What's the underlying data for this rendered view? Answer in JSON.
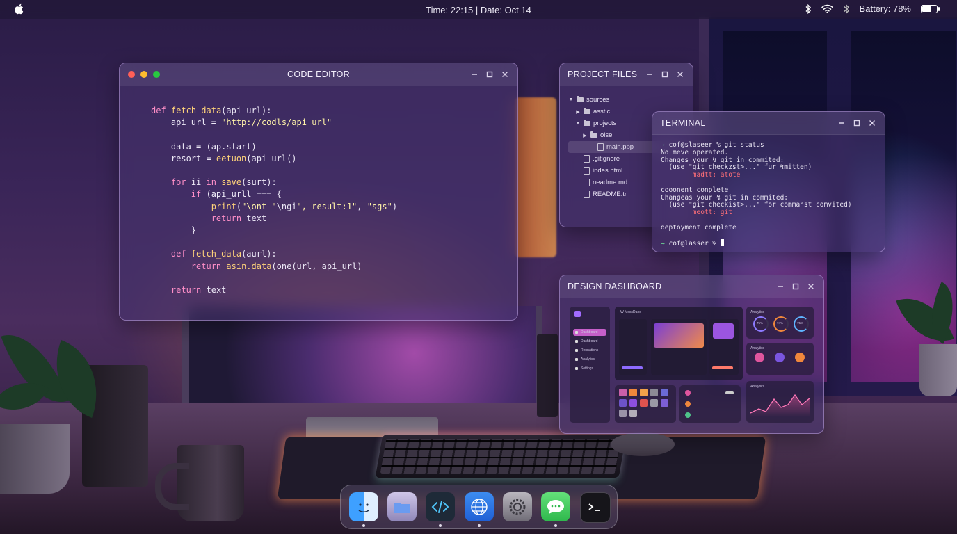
{
  "menubar": {
    "clock": "Time: 22:15 | Date: Oct 14",
    "battery": "Battery: 78%",
    "battery_level": 0.78
  },
  "code_editor": {
    "title": "CODE EDITOR",
    "lines": [
      "def fetch_data(api_url):",
      "    api_url = \"http://codls/api_url\"",
      "",
      "    data = (ap.start)",
      "    resort = eetuon(api_url()",
      "",
      "    for ii in save(surt):",
      "        if (api_urll === {",
      "            print(\"\\ont \"\\ngi\", result:1\", \"sgs\")",
      "            return text",
      "        }",
      "",
      "    def fetch_data(aurl):",
      "        return asin.data(one(url, api_url)",
      "",
      "    return text"
    ]
  },
  "project_files": {
    "title": "PROJECT FILES",
    "items": [
      {
        "label": "sources",
        "type": "folder",
        "depth": 0,
        "chevron": "open"
      },
      {
        "label": "asstic",
        "type": "folder",
        "depth": 1,
        "chevron": "closed"
      },
      {
        "label": "projects",
        "type": "folder",
        "depth": 1,
        "chevron": "open"
      },
      {
        "label": "oise",
        "type": "folder",
        "depth": 2,
        "chevron": "closed"
      },
      {
        "label": "main.ppp",
        "type": "file",
        "depth": 3,
        "selected": true
      },
      {
        "label": ".gitignore",
        "type": "file",
        "depth": 1
      },
      {
        "label": "indes.html",
        "type": "file",
        "depth": 1
      },
      {
        "label": "neadme.md",
        "type": "file",
        "depth": 1
      },
      {
        "label": "README.tr",
        "type": "file",
        "depth": 1
      }
    ]
  },
  "terminal": {
    "title": "TERMINAL",
    "lines": [
      {
        "text": "→ cof@slaseer % git status",
        "style": "prompt"
      },
      {
        "text": "No meve operated.",
        "style": "normal"
      },
      {
        "text": "Changes your ↯ git in commited:",
        "style": "normal"
      },
      {
        "text": "  (use \"git checkzst>...\" fur ↯mitten)",
        "style": "normal"
      },
      {
        "text": "        madtt: atote",
        "style": "red"
      },
      {
        "text": "",
        "style": "normal"
      },
      {
        "text": "cooonent conplete",
        "style": "normal"
      },
      {
        "text": "Changeas your ↯ git in commited:",
        "style": "normal"
      },
      {
        "text": "  (use \"git checkist>...\" for commanst comvited)",
        "style": "normal"
      },
      {
        "text": "        meott: git",
        "style": "red"
      },
      {
        "text": "",
        "style": "normal"
      },
      {
        "text": "deptoyment complete",
        "style": "normal"
      },
      {
        "text": "",
        "style": "normal"
      }
    ],
    "prompt": "cof@lasser %"
  },
  "design_dashboard": {
    "title": "DESIGN DASHBOARD",
    "app_name": "W MossDand",
    "sidebar": [
      "Dashboard",
      "Dashboard",
      "Rennations",
      "Analytics",
      "Settings"
    ],
    "cards": {
      "analytics_1": "Analytics",
      "analytics_2": "Analytics",
      "analytics_3": "Analytics",
      "gauges": [
        "75%",
        "74%",
        "75%"
      ]
    },
    "swatches": [
      "#c95fa8",
      "#f0873c",
      "#f2a24a",
      "#8c8a96",
      "#6b6bd6",
      "#6d53c8",
      "#8d4fe0",
      "#e0534f",
      "#9a9aa6",
      "#7d5fd6",
      "#9a92a8",
      "#b3adb9"
    ]
  },
  "dock": {
    "apps": [
      "finder-icon",
      "folder-icon",
      "code-icon",
      "globe-icon",
      "settings-icon",
      "messages-icon",
      "terminal-icon"
    ],
    "running": [
      true,
      false,
      true,
      true,
      false,
      true,
      false
    ]
  },
  "colors": {
    "accent": "#b57cff",
    "traffic_close": "#ff5f57",
    "traffic_min": "#febc2e",
    "traffic_max": "#28c840"
  }
}
